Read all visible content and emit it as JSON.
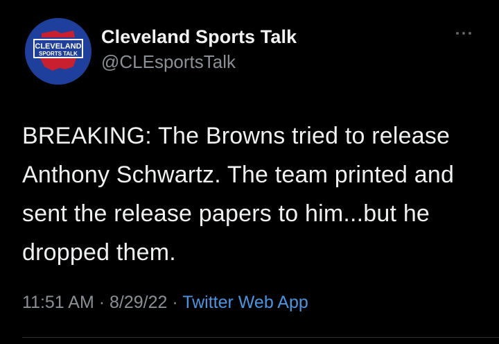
{
  "account": {
    "display_name": "Cleveland Sports Talk",
    "handle": "@CLEsportsTalk",
    "avatar": {
      "icon": "team-logo-avatar",
      "line1": "CLEVELAND",
      "line2": "SPORTS TALK",
      "colors": {
        "background": "#1f3f9c",
        "accent": "#c8202f",
        "text": "#ffffff"
      }
    }
  },
  "more_menu": {
    "icon": "more-horizontal-icon"
  },
  "tweet": {
    "text": "BREAKING: The Browns tried to release Anthony Schwartz. The team printed and sent the release papers to him...but he dropped them.",
    "time": "11:51 AM",
    "date": "8/29/22",
    "separator": "·",
    "source": "Twitter Web App"
  },
  "colors": {
    "background": "#000000",
    "primary_text": "#eef0f1",
    "secondary_text": "#8b9096",
    "link": "#4a95e0"
  }
}
